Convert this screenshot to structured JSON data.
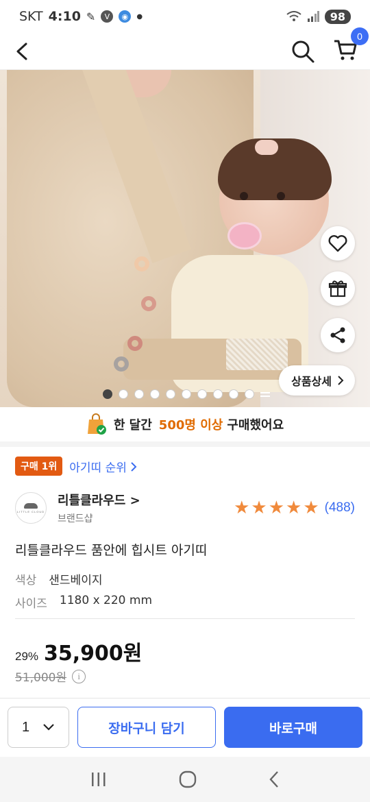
{
  "status_bar": {
    "carrier": "SKT",
    "time": "4:10",
    "battery": "98"
  },
  "top_nav": {
    "cart_count": "0"
  },
  "hero": {
    "detail_button_label": "상품상세",
    "image_count": 10,
    "active_index": 0
  },
  "purchase_banner": {
    "prefix": "한 달간",
    "highlight": "500명 이상",
    "suffix": "구매했어요"
  },
  "rank": {
    "badge": "구매 1위",
    "link": "아기띠 순위"
  },
  "brand": {
    "name": "리틀클라우드",
    "sub": "브랜드샵",
    "logo_text": "LITTLE CLOUD",
    "rating_stars": 5,
    "review_count": "(488)"
  },
  "product": {
    "title": "리틀클라우드 품안에 힙시트 아기띠",
    "options": [
      {
        "label": "색상",
        "value": "샌드베이지"
      },
      {
        "label": "사이즈",
        "value": "1180 x 220 mm"
      }
    ]
  },
  "price": {
    "discount": "29%",
    "sale": "35,900원",
    "original": "51,000원"
  },
  "bottom_bar": {
    "quantity": "1",
    "cart_label": "장바구니 담기",
    "buy_label": "바로구매"
  },
  "colors": {
    "accent_blue": "#3a6cf0",
    "rank_orange": "#e25a12",
    "highlight_orange": "#e06b00",
    "star_orange": "#f08a3c"
  }
}
